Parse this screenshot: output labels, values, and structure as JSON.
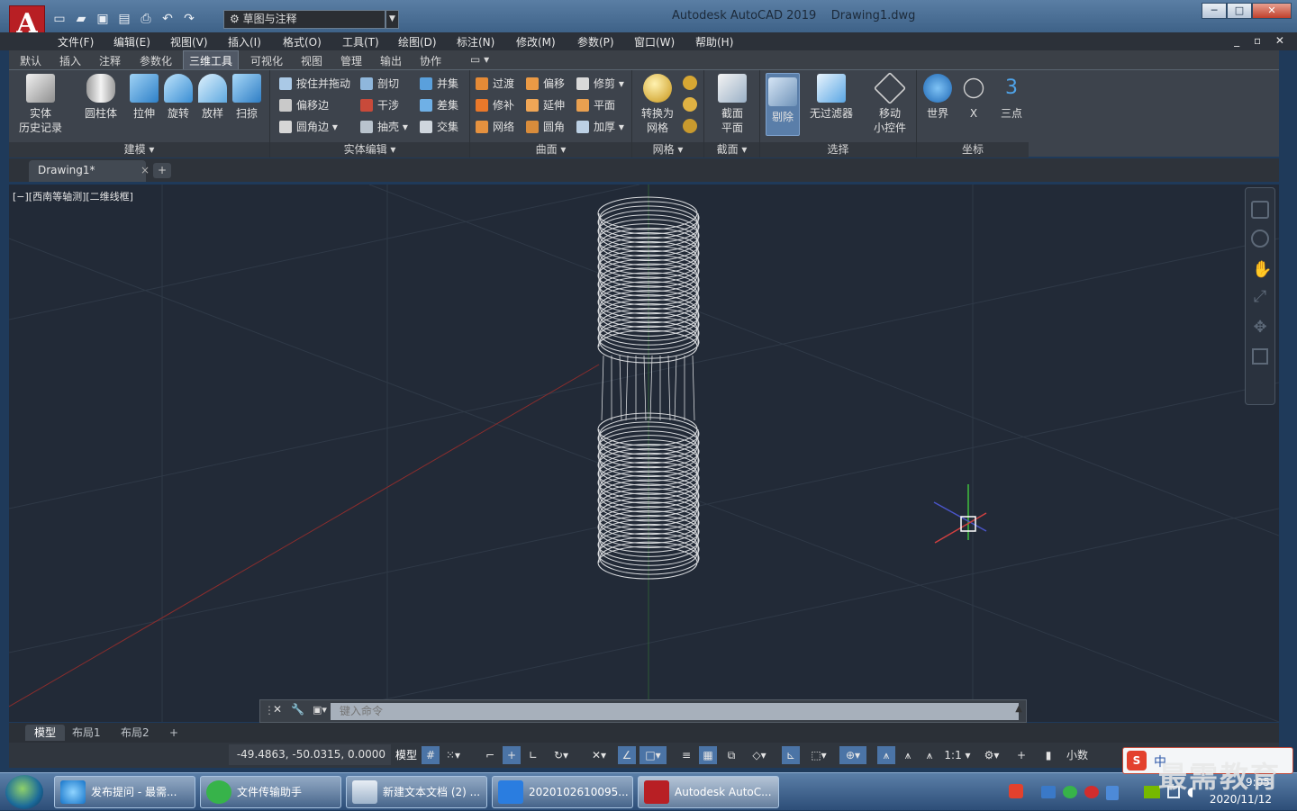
{
  "app": {
    "logo": "A",
    "title": "Autodesk AutoCAD 2019",
    "document": "Drawing1.dwg"
  },
  "qat": {
    "workspace": "草图与注释",
    "icons": [
      "new-icon",
      "open-icon",
      "save-icon",
      "saveas-icon",
      "plot-icon",
      "undo-icon",
      "redo-icon"
    ]
  },
  "window_controls": {
    "minimize": "─",
    "maximize": "□",
    "close": "✕"
  },
  "menu": [
    "文件(F)",
    "编辑(E)",
    "视图(V)",
    "插入(I)",
    "格式(O)",
    "工具(T)",
    "绘图(D)",
    "标注(N)",
    "修改(M)",
    "参数(P)",
    "窗口(W)",
    "帮助(H)"
  ],
  "doc_controls": "_ ▫ ✕",
  "ribbon_tabs": [
    "默认",
    "插入",
    "注释",
    "参数化",
    "三维工具",
    "可视化",
    "视图",
    "管理",
    "输出",
    "协作"
  ],
  "ribbon_active_tab": "三维工具",
  "panels": {
    "modeling": {
      "title": "建模 ▾",
      "buttons": [
        "实体\n历史记录",
        "圆柱体",
        "拉伸",
        "旋转",
        "放样",
        "扫掠"
      ]
    },
    "solid_edit": {
      "title": "实体编辑 ▾",
      "buttons": [
        "按住并拖动",
        "偏移边",
        "圆角边 ▾",
        "剖切",
        "干涉",
        "抽壳 ▾",
        "并集",
        "差集",
        "交集"
      ]
    },
    "surface": {
      "title": "曲面 ▾",
      "buttons": [
        "过渡",
        "修补",
        "网络",
        "偏移",
        "延伸",
        "圆角",
        "修剪 ▾",
        "平面",
        "加厚 ▾"
      ]
    },
    "mesh": {
      "title": "网格 ▾",
      "buttons": [
        "转换为\n网格"
      ]
    },
    "section": {
      "title": "截面 ▾",
      "buttons": [
        "截面\n平面"
      ]
    },
    "selection": {
      "title": "选择",
      "buttons": [
        "剔除",
        "无过滤器",
        "移动\n小控件"
      ]
    },
    "coordinates": {
      "title": "坐标",
      "buttons": [
        "世界",
        "X",
        "三点"
      ]
    }
  },
  "file_tab": {
    "name": "Drawing1*",
    "close": "×",
    "new": "+"
  },
  "viewport": {
    "label": "[−][西南等轴测][二维线框]",
    "bg": "#222a37"
  },
  "command": {
    "placeholder": "键入命令"
  },
  "layout_tabs": [
    "模型",
    "布局1",
    "布局2",
    "+"
  ],
  "status": {
    "coords": "-49.4863, -50.0315, 0.0000",
    "model": "模型",
    "scale": "1:1",
    "units": "小数"
  },
  "taskbar": {
    "items": [
      "发布提问 - 最需...",
      "文件传输助手",
      "新建文本文档 (2) ...",
      "2020102610095...",
      "Autodesk AutoC..."
    ]
  },
  "tray": {
    "time": "9:05",
    "date": "2020/11/12"
  },
  "ime": {
    "logo": "S",
    "lang": "中"
  },
  "watermark": "最需教育"
}
